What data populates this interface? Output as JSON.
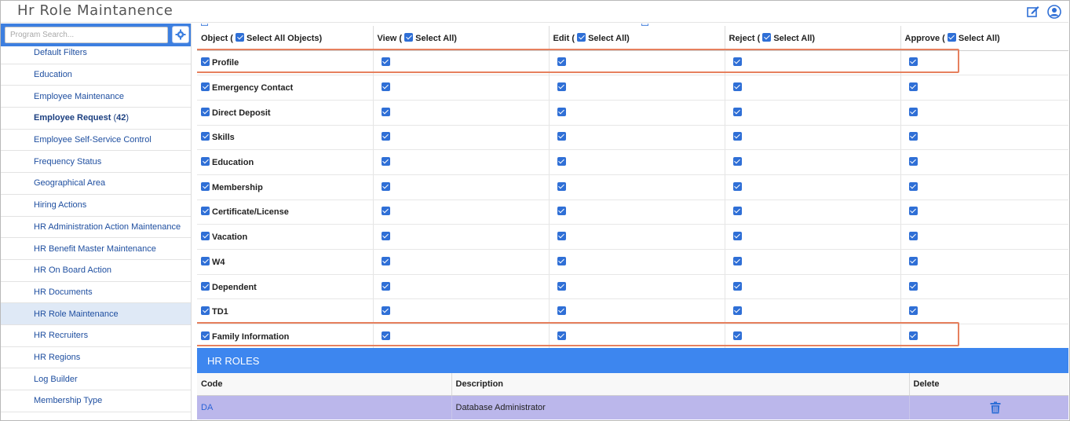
{
  "app": {
    "title": "Hr Role Maintanence"
  },
  "search": {
    "placeholder": "Program Search..."
  },
  "sidebar": {
    "items": [
      {
        "label": "Default Filters"
      },
      {
        "label": "Education"
      },
      {
        "label": "Employee Maintenance"
      },
      {
        "label": "Employee Request",
        "count": "42"
      },
      {
        "label": "Employee Self-Service Control"
      },
      {
        "label": "Frequency Status"
      },
      {
        "label": "Geographical Area"
      },
      {
        "label": "Hiring Actions"
      },
      {
        "label": "HR Administration Action Maintenance"
      },
      {
        "label": "HR Benefit Master Maintenance"
      },
      {
        "label": "HR On Board Action"
      },
      {
        "label": "HR Documents"
      },
      {
        "label": "HR Role Maintenance"
      },
      {
        "label": "HR Recruiters"
      },
      {
        "label": "HR Regions"
      },
      {
        "label": "Log Builder"
      },
      {
        "label": "Membership Type"
      }
    ],
    "active_index": 12
  },
  "permissions": {
    "headers": {
      "object_prefix": "Object (",
      "object_select": "Select All Objects)",
      "view_prefix": "View (",
      "edit_prefix": "Edit (",
      "reject_prefix": "Reject (",
      "approve_prefix": "Approve (",
      "select_all": "Select All)"
    },
    "rows": [
      {
        "name": "Profile",
        "view": true,
        "edit": true,
        "reject": true,
        "approve": true
      },
      {
        "name": "Emergency Contact",
        "view": true,
        "edit": true,
        "reject": true,
        "approve": true
      },
      {
        "name": "Direct Deposit",
        "view": true,
        "edit": true,
        "reject": true,
        "approve": true
      },
      {
        "name": "Skills",
        "view": true,
        "edit": true,
        "reject": true,
        "approve": true
      },
      {
        "name": "Education",
        "view": true,
        "edit": true,
        "reject": true,
        "approve": true
      },
      {
        "name": "Membership",
        "view": true,
        "edit": true,
        "reject": true,
        "approve": true
      },
      {
        "name": "Certificate/License",
        "view": true,
        "edit": true,
        "reject": true,
        "approve": true
      },
      {
        "name": "Vacation",
        "view": true,
        "edit": true,
        "reject": true,
        "approve": true
      },
      {
        "name": "W4",
        "view": true,
        "edit": true,
        "reject": true,
        "approve": true
      },
      {
        "name": "Dependent",
        "view": true,
        "edit": true,
        "reject": true,
        "approve": true
      },
      {
        "name": "TD1",
        "view": true,
        "edit": true,
        "reject": true,
        "approve": true
      },
      {
        "name": "Family Information",
        "view": true,
        "edit": true,
        "reject": true,
        "approve": true
      }
    ],
    "highlight_color": "#e6805e"
  },
  "roles": {
    "section_title": "HR ROLES",
    "columns": {
      "code": "Code",
      "description": "Description",
      "delete": "Delete"
    },
    "rows": [
      {
        "code": "DA",
        "description": "Database Administrator"
      }
    ]
  },
  "colors": {
    "accent": "#3d86ef",
    "selected_row": "#bbb7eb",
    "link": "#1f4fa0"
  },
  "icons": {
    "edit": "edit-icon",
    "user": "user-icon",
    "gear": "gear-icon",
    "trash": "trash-icon"
  }
}
